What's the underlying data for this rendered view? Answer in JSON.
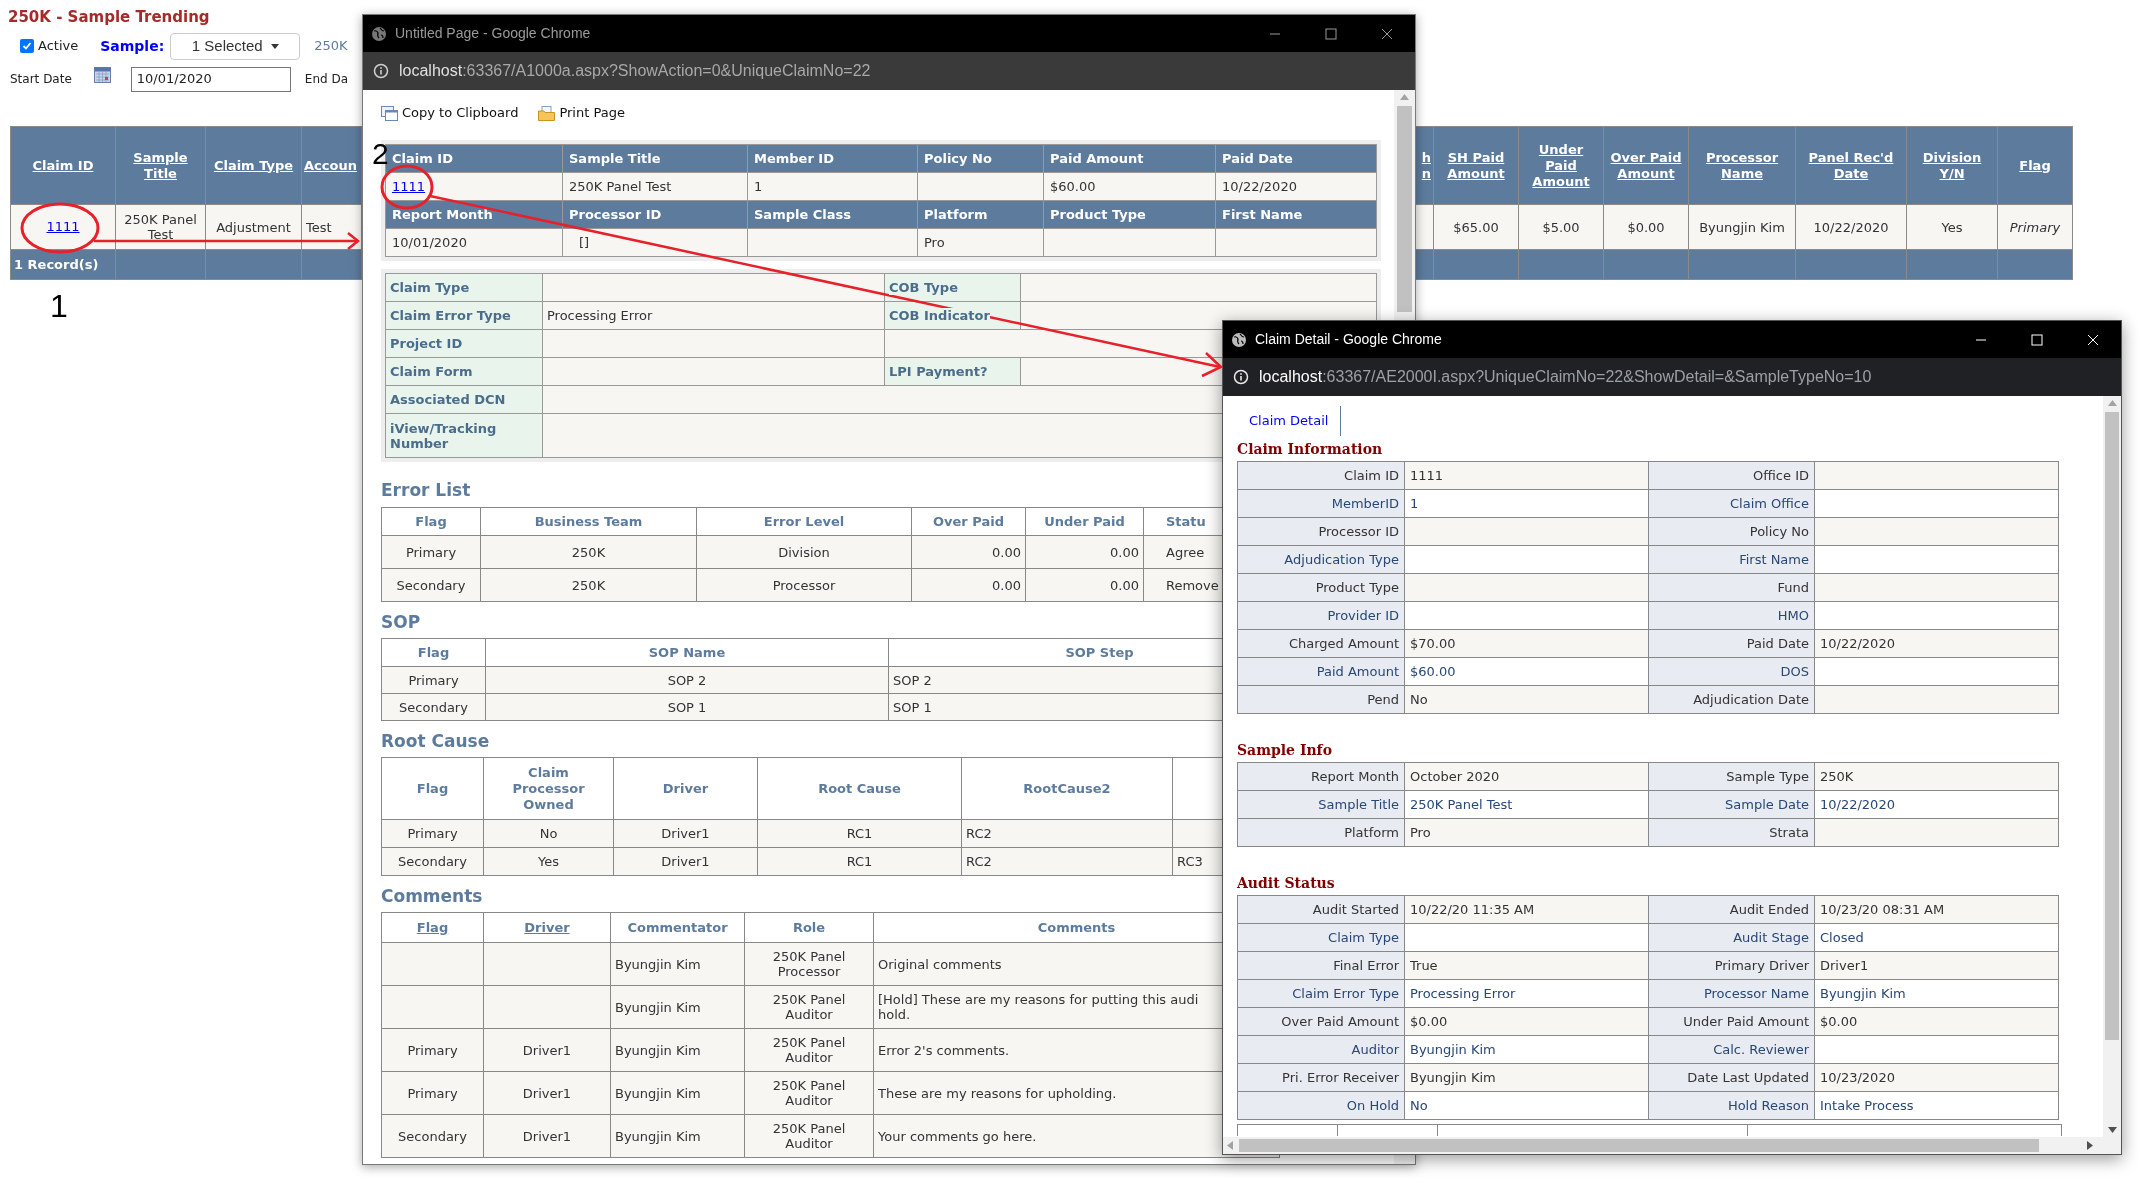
{
  "page": {
    "title": "250K - Sample Trending",
    "active": {
      "label": "Active",
      "checked": true
    },
    "sample_label": "Sample:",
    "sample_value": "1 Selected",
    "sample_text": "250K",
    "start_date_label": "Start Date",
    "start_date": "10/01/2020",
    "end_date_label": "End Da"
  },
  "table": {
    "columns": [
      "Claim ID",
      "Sample Title",
      "Claim Type",
      "Accoun",
      "h n",
      "SH Paid Amount",
      "Under Paid Amount",
      "Over Paid Amount",
      "Processor Name",
      "Panel Rec'd Date",
      "Division Y/N",
      "Flag"
    ],
    "rows": [
      {
        "cells": [
          "1111",
          "250K Panel Test",
          "Adjustment",
          "Test",
          "",
          "$65.00",
          "$5.00",
          "$0.00",
          "Byungjin Kim",
          "10/22/2020",
          "Yes",
          "Primary"
        ]
      }
    ],
    "footer": "1 Record(s)"
  },
  "markers": [
    "1",
    "2"
  ],
  "window1": {
    "title": "Untitled Page - Google Chrome",
    "url_host": "localhost",
    "url_rest": ":63367/A1000a.aspx?ShowAction=0&UniqueClaimNo=22",
    "toolbar": [
      "Copy to Clipboard",
      "Print Page"
    ],
    "summary": [
      [
        {
          "header": "Claim ID",
          "value": "1111"
        },
        {
          "header": "Sample Title",
          "value": "250K Panel Test"
        },
        {
          "header": "Member ID",
          "value": "1"
        },
        {
          "header": "Policy No"
        },
        {
          "header": "Paid Amount",
          "value": "$60.00"
        },
        {
          "header": "Paid Date",
          "value": "10/22/2020"
        }
      ],
      [
        {
          "header": "Report Month",
          "value": "10/01/2020"
        },
        {
          "header": "Processor ID",
          "value": "[]"
        },
        {
          "header": "Sample Class"
        },
        {
          "header": "Platform",
          "value": "Pro"
        },
        {
          "header": "Product Type"
        },
        {
          "header": "First Name"
        }
      ]
    ],
    "details": [
      {
        "kind": "pair",
        "label": "Claim Type",
        "label2": "COB Type"
      },
      {
        "kind": "pair",
        "label": "Claim Error Type",
        "value": "Processing Error",
        "label2": "COB Indicator"
      },
      {
        "kind": "half",
        "label": "Project ID"
      },
      {
        "kind": "pair",
        "label": "Claim Form",
        "label2": "LPI Payment?"
      },
      {
        "kind": "wide",
        "label": "Associated DCN"
      },
      {
        "kind": "wide",
        "label": "iView/Tracking Number"
      }
    ],
    "error_list": {
      "title": "Error List",
      "columns": [
        "Flag",
        "Business Team",
        "Error Level",
        "Over Paid",
        "Under Paid",
        "Statu"
      ],
      "rows": [
        [
          "Primary",
          "250K",
          "Division",
          "0.00",
          "0.00",
          "Agree"
        ],
        [
          "Secondary",
          "250K",
          "Processor",
          "0.00",
          "0.00",
          "Remove"
        ]
      ]
    },
    "sop": {
      "title": "SOP",
      "columns": [
        "Flag",
        "SOP Name",
        "SOP Step"
      ],
      "rows": [
        [
          "Primary",
          "SOP 2",
          "SOP 2"
        ],
        [
          "Secondary",
          "SOP 1",
          "SOP 1"
        ]
      ]
    },
    "root_cause": {
      "title": "Root Cause",
      "columns": [
        "Flag",
        "Claim Processor Owned",
        "Driver",
        "Root Cause",
        "RootCause2"
      ],
      "rows": [
        {
          "flag": "Primary",
          "owned": "No",
          "driver": "Driver1",
          "root_cause": "RC1",
          "root_cause2": "RC2"
        },
        {
          "flag": "Secondary",
          "owned": "Yes",
          "driver": "Driver1",
          "root_cause": "RC1",
          "root_cause2": "RC2",
          "root_cause3": "RC3"
        }
      ]
    },
    "comments": {
      "title": "Comments",
      "columns": [
        {
          "label": "Flag",
          "sortable": true
        },
        {
          "label": "Driver",
          "sortable": true
        },
        {
          "label": "Commentator",
          "sortable": false
        },
        {
          "label": "Role",
          "sortable": false
        },
        {
          "label": "Comments",
          "sortable": false
        }
      ],
      "rows": [
        {
          "commentator": "Byungjin Kim",
          "role": "250K Panel Processor",
          "comment": "Original comments"
        },
        {
          "commentator": "Byungjin Kim",
          "role": "250K Panel Auditor",
          "comment": "[Hold] These are my reasons for putting this audi\nhold."
        },
        {
          "flag": "Primary",
          "driver": "Driver1",
          "commentator": "Byungjin Kim",
          "role": "250K Panel Auditor",
          "comment": "Error 2's comments."
        },
        {
          "flag": "Primary",
          "driver": "Driver1",
          "commentator": "Byungjin Kim",
          "role": "250K Panel Auditor",
          "comment": "These are my reasons for upholding."
        },
        {
          "flag": "Secondary",
          "driver": "Driver1",
          "commentator": "Byungjin Kim",
          "role": "250K Panel Auditor",
          "comment": "Your comments go here."
        }
      ]
    }
  },
  "window2": {
    "title": "Claim Detail - Google Chrome",
    "url_host": "localhost",
    "url_rest": ":63367/AE2000I.aspx?UniqueClaimNo=22&ShowDetail=&SampleTypeNo=10",
    "tab": {
      "label": "Claim Detail",
      "selected": true
    },
    "sections": [
      {
        "title": "Claim Information",
        "rows": [
          {
            "label": "Claim ID",
            "value": "1111",
            "label2": "Office ID"
          },
          {
            "label": "MemberID",
            "value": "1",
            "label2": "Claim Office"
          },
          {
            "label": "Processor ID",
            "label2": "Policy No"
          },
          {
            "label": "Adjudication Type",
            "label2": "First Name"
          },
          {
            "label": "Product Type",
            "label2": "Fund"
          },
          {
            "label": "Provider ID",
            "label2": "HMO"
          },
          {
            "label": "Charged Amount",
            "value": "$70.00",
            "label2": "Paid Date",
            "value2": "10/22/2020"
          },
          {
            "label": "Paid Amount",
            "value": "$60.00",
            "label2": "DOS"
          },
          {
            "label": "Pend",
            "value": "No",
            "label2": "Adjudication Date"
          }
        ]
      },
      {
        "title": "Sample Info",
        "rows": [
          {
            "label": "Report Month",
            "value": "October 2020",
            "label2": "Sample Type",
            "value2": "250K"
          },
          {
            "label": "Sample Title",
            "value": "250K Panel Test",
            "label2": "Sample Date",
            "value2": "10/22/2020"
          },
          {
            "label": "Platform",
            "value": "Pro",
            "label2": "Strata"
          }
        ]
      },
      {
        "title": "Audit Status",
        "rows": [
          {
            "label": "Audit Started",
            "value": "10/22/20 11:35 AM",
            "label2": "Audit Ended",
            "value2": "10/23/20 08:31 AM"
          },
          {
            "label": "Claim Type",
            "label2": "Audit Stage",
            "value2": "Closed"
          },
          {
            "label": "Final Error",
            "value": "True",
            "label2": "Primary Driver",
            "value2": "Driver1"
          },
          {
            "label": "Claim Error Type",
            "value": "Processing Error",
            "label2": "Processor Name",
            "value2": "Byungjin Kim"
          },
          {
            "label": "Over Paid Amount",
            "value": "$0.00",
            "label2": "Under Paid Amount",
            "value2": "$0.00"
          },
          {
            "label": "Auditor",
            "value": "Byungjin Kim",
            "label2": "Calc. Reviewer"
          },
          {
            "label": "Pri. Error Receiver",
            "value": "Byungjin Kim",
            "label2": "Date Last Updated",
            "value2": "10/23/2020"
          },
          {
            "label": "On Hold",
            "value": "No",
            "label2": "Hold Reason",
            "value2": "Intake Process"
          }
        ]
      }
    ]
  }
}
